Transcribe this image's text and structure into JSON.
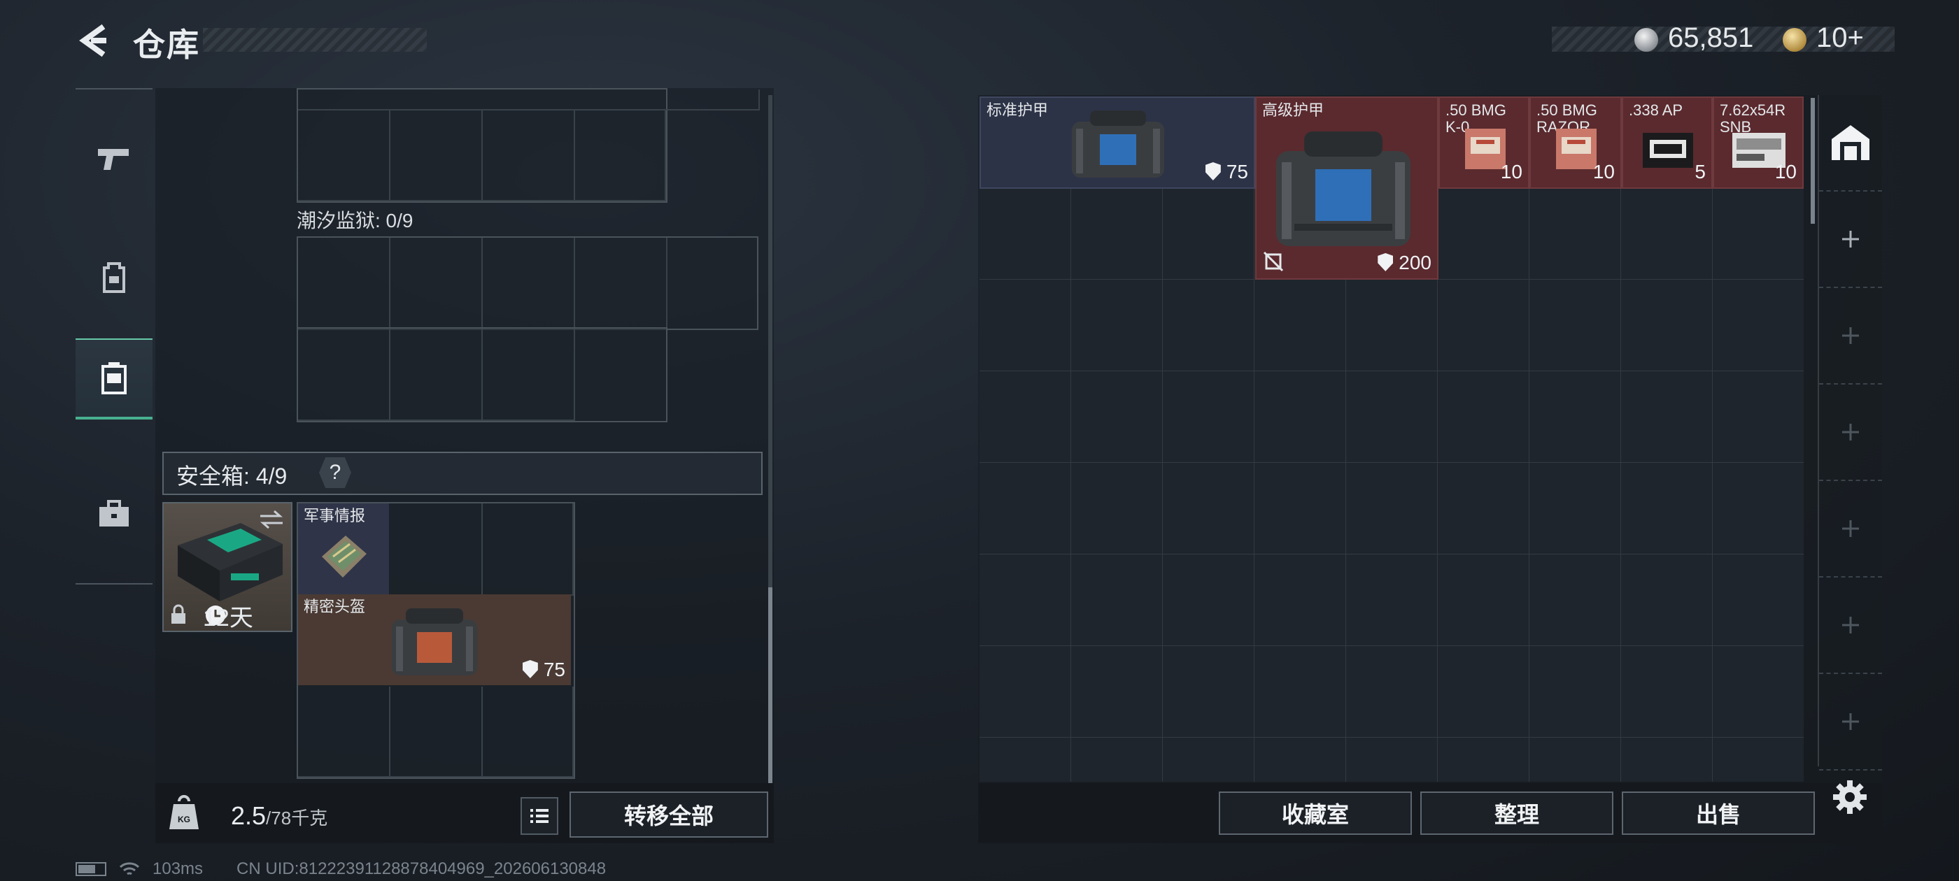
{
  "header": {
    "title": "仓库",
    "currency": {
      "coins": "65,851",
      "tokens": "10+"
    }
  },
  "left": {
    "prison_label": "潮汐监狱: 0/9",
    "safe_label": "安全箱: 4/9",
    "safe_help": "?",
    "safe_timer": "12天",
    "safe_items": [
      {
        "name": "军事情报"
      },
      {
        "name": "精密头盔",
        "value": "75"
      }
    ],
    "weight": {
      "current": "2.5",
      "max": "/78千克"
    },
    "transfer_all": "转移全部"
  },
  "stash": {
    "items": [
      {
        "name": "标准护甲",
        "value": "75"
      },
      {
        "name": "高级护甲",
        "value": "200"
      },
      {
        "name": ".50 BMG K-0",
        "count": "10"
      },
      {
        "name": ".50 BMG RAZOR",
        "count": "10"
      },
      {
        "name": ".338 AP",
        "count": "5"
      },
      {
        "name": "7.62x54R SNB",
        "count": "10"
      }
    ]
  },
  "bottom_buttons": {
    "collection": "收藏室",
    "organize": "整理",
    "sell": "出售"
  },
  "status": {
    "ping": "103ms",
    "uid": "CN UID:81222391128878404969_202606130848"
  },
  "colors": {
    "accent": "#48b08f",
    "item_red": "#5a2a2e",
    "item_blue": "#2d3347",
    "item_brown": "#4a3a33"
  }
}
